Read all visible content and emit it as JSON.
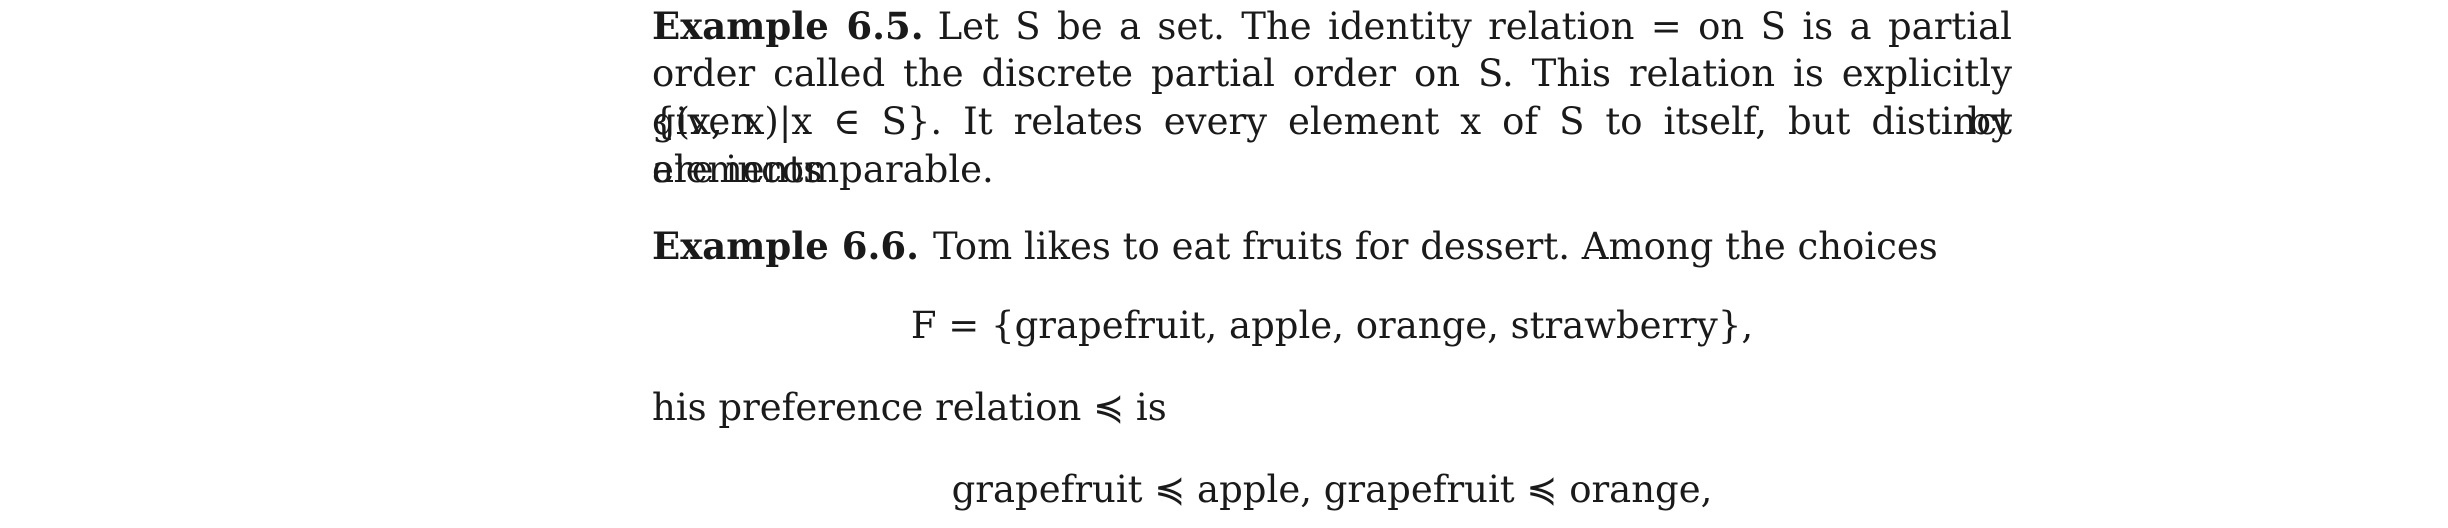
{
  "example_6_5": {
    "label": "Example 6.5.",
    "line1": "Let S be a set.  The identity relation = on S is a partial",
    "line2": "order called the discrete partial order on S. This relation is explicitly given by",
    "line3": "{(x, x)|x ∈ S}. It relates every element x of S to itself, but distinct elements",
    "line4": "are incomparable."
  },
  "example_6_6": {
    "label": "Example 6.6.",
    "text": "Tom likes to eat fruits for dessert. Among the choices",
    "set_display": "F = {grapefruit, apple, orange, strawberry},",
    "relation_intro": "his preference relation ≼ is",
    "relation_display": "grapefruit ≼ apple,  grapefruit ≼ orange,"
  }
}
